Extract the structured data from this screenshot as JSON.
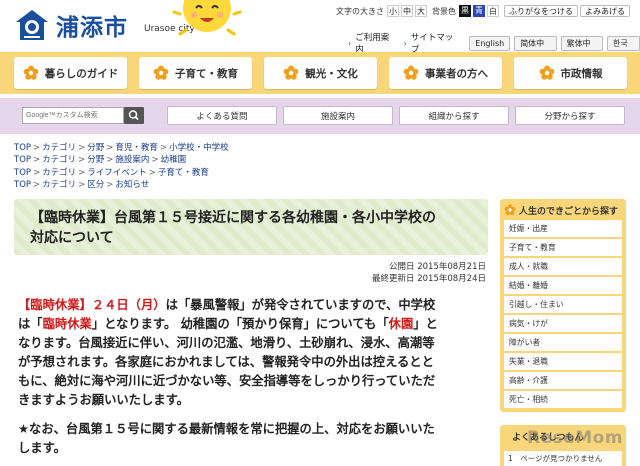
{
  "header": {
    "city_name": "浦添市",
    "city_roman": "Urasoe city",
    "font_size_label": "文字の大きさ",
    "font_sizes": [
      "小",
      "中",
      "大"
    ],
    "bg_color_label": "背景色",
    "bg_colors": [
      {
        "label": "黒",
        "color": "#111111"
      },
      {
        "label": "青",
        "color": "#2a45b5"
      },
      {
        "label": "白",
        "color": "#ffffff"
      }
    ],
    "furigana_label": "ふりがなをつける",
    "readaloud_label": "よみあげる",
    "guide_label": "ご利用案内",
    "sitemap_label": "サイトマップ",
    "languages": [
      "English",
      "简体中文",
      "繁体中文",
      "한국어"
    ]
  },
  "nav": {
    "items": [
      "暮らしのガイド",
      "子育て・教育",
      "観光・文化",
      "事業者の方へ",
      "市政情報"
    ]
  },
  "search": {
    "placeholder": "Google™カスタム検索"
  },
  "subnav": {
    "items": [
      "よくある質問",
      "施設案内",
      "組織から探す",
      "分野から探す"
    ]
  },
  "breadcrumbs": [
    [
      "TOP",
      "カテゴリ",
      "分野",
      "育児・教育",
      "小学校・中学校"
    ],
    [
      "TOP",
      "カテゴリ",
      "分野",
      "施設案内",
      "幼稚園"
    ],
    [
      "TOP",
      "カテゴリ",
      "ライフイベント",
      "子育て・教育"
    ],
    [
      "TOP",
      "カテゴリ",
      "区分",
      "お知らせ"
    ]
  ],
  "article": {
    "title_line1": "【臨時休業】台風第１５号接近に関する各幼稚園・各小中学校の",
    "title_line2": "対応について",
    "published": "公開日 2015年08月21日",
    "updated": "最終更新日 2015年08月24日",
    "p1_a": "【臨時休業】２４日（月）",
    "p1_b": "は「暴風警報」が発令されていますので、中学校",
    "p1_c": "は「",
    "p1_d": "臨時休業",
    "p1_e": "」となります。 幼稚園の「預かり保育」についても「",
    "p1_f": "休園",
    "p1_g": "」と",
    "p1_h": "なります。台風接近に伴い、河川の氾濫、地滑り、土砂崩れ、浸水、高潮等",
    "p1_i": "が予想されます。各家庭におかれましては、警報発令中の外出は控えるとと",
    "p1_j": "もに、絶対に海や河川に近づかない等、安全指導等をしっかり行っていただ",
    "p1_k": "きますようお願いいたします。",
    "note_1": "★なお、台風第１５号に関する最新情報を常に把握の上、対応をお願いいた",
    "note_2": "します。"
  },
  "sidebar": {
    "heading": "人生のできごとから探す",
    "items": [
      "妊娠・出産",
      "子育て・教育",
      "成人・就職",
      "結婚・離婚",
      "引越し・住まい",
      "病気・けが",
      "障がい者",
      "失業・退職",
      "高齢・介護",
      "死亡・相続"
    ],
    "heading2": "よくあるしつもん",
    "item2": "1　ページが見つかりません"
  },
  "watermark": "ReseMom",
  "colors": {
    "nav_bg": "#f9d67a",
    "subnav_bg": "#e5d6eb",
    "title_bg": "#dfeccb",
    "accent_red": "#d21a1a",
    "logo_blue": "#1a4fa0"
  }
}
